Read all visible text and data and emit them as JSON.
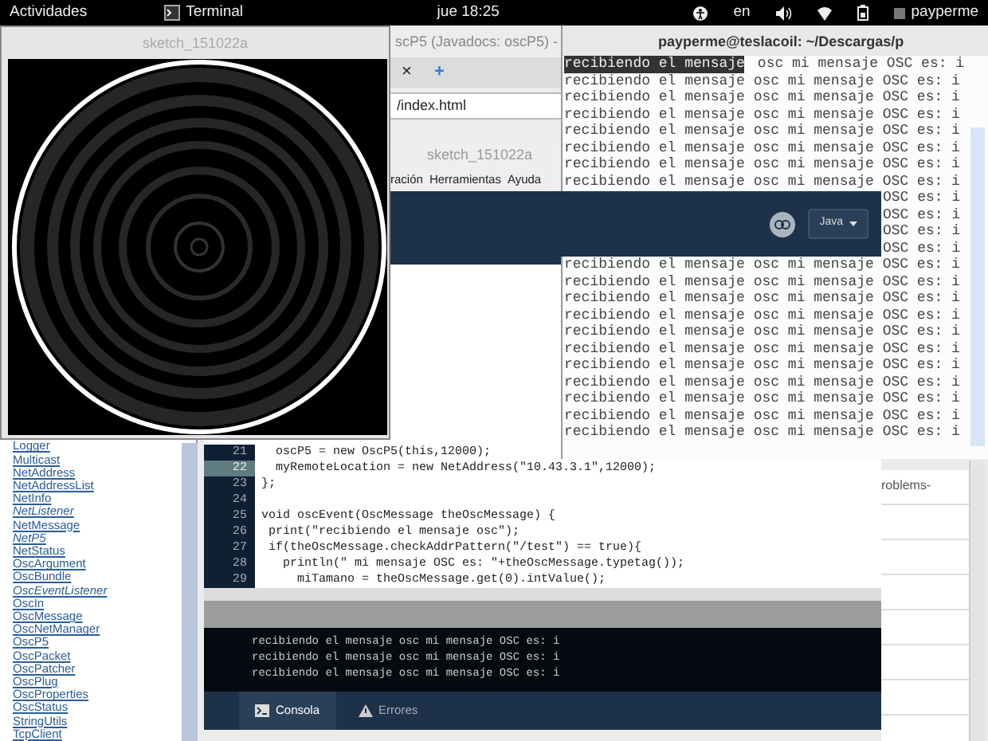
{
  "top_bar": {
    "activities": "Actividades",
    "app": "Terminal",
    "clock": "jue 18:25",
    "language": "en",
    "user": "payperme"
  },
  "browser": {
    "title": "scP5 (Javadocs: oscP5) -",
    "tab_close": "×",
    "new_tab": "+",
    "url": "/index.html",
    "content_text": "roblems-",
    "classes": [
      {
        "label": "Logger",
        "kind": "class"
      },
      {
        "label": "Multicast",
        "kind": "class"
      },
      {
        "label": "NetAddress",
        "kind": "class"
      },
      {
        "label": "NetAddressList",
        "kind": "class"
      },
      {
        "label": "NetInfo",
        "kind": "class"
      },
      {
        "label": "NetListener",
        "kind": "interface"
      },
      {
        "label": "NetMessage",
        "kind": "class"
      },
      {
        "label": "NetP5",
        "kind": "interface"
      },
      {
        "label": "NetStatus",
        "kind": "class"
      },
      {
        "label": "OscArgument",
        "kind": "class"
      },
      {
        "label": "OscBundle",
        "kind": "class"
      },
      {
        "label": "OscEventListener",
        "kind": "interface"
      },
      {
        "label": "OscIn",
        "kind": "class"
      },
      {
        "label": "OscMessage",
        "kind": "class"
      },
      {
        "label": "OscNetManager",
        "kind": "class"
      },
      {
        "label": "OscP5",
        "kind": "class"
      },
      {
        "label": "OscPacket",
        "kind": "class"
      },
      {
        "label": "OscPatcher",
        "kind": "class"
      },
      {
        "label": "OscPlug",
        "kind": "class"
      },
      {
        "label": "OscProperties",
        "kind": "class"
      },
      {
        "label": "OscStatus",
        "kind": "class"
      },
      {
        "label": "StringUtils",
        "kind": "class"
      },
      {
        "label": "TcpClient",
        "kind": "class"
      }
    ]
  },
  "editor": {
    "title": "sketch_151022a",
    "menu": [
      "ración",
      "Herramientas",
      "Ayuda"
    ],
    "mode": "Java",
    "code_lines": [
      {
        "number": "21",
        "code": "  oscP5 = new OscP5(this,12000);",
        "selected": false
      },
      {
        "number": "22",
        "code": "  myRemoteLocation = new NetAddress(\"10.43.3.1\",12000);",
        "selected": true
      },
      {
        "number": "23",
        "code": "};",
        "selected": false
      },
      {
        "number": "24",
        "selected": false
      },
      {
        "number": "25",
        "code": "void oscEvent(OscMessage theOscMessage) {",
        "selected": false
      },
      {
        "number": "26",
        "code": " print(\"recibiendo el mensaje osc\");",
        "selected": false
      },
      {
        "number": "27",
        "code": " if(theOscMessage.checkAddrPattern(\"/test\") == true){",
        "selected": false
      },
      {
        "number": "28",
        "code": "   println(\" mi mensaje OSC es: \"+theOscMessage.typetag());",
        "selected": false
      },
      {
        "number": "29",
        "code": "     miTamano = theOscMessage.get(0).intValue();",
        "selected": false
      }
    ],
    "console_lines": [
      "recibiendo el mensaje osc mi mensaje OSC es: i",
      "recibiendo el mensaje osc mi mensaje OSC es: i",
      "recibiendo el mensaje osc mi mensaje OSC es: i"
    ],
    "console_tabs": [
      {
        "label": "Consola",
        "kind": "console",
        "selected": true
      },
      {
        "label": "Errores",
        "kind": "errors",
        "selected": false
      }
    ]
  },
  "sketch_window": {
    "title": "sketch_151022a"
  },
  "terminal": {
    "title": "payperme@teslacoil: ~/Descargas/p",
    "lines": [
      {
        "kind": "full",
        "selection": "recibiendo el mensaje",
        "text": "osc mi mensaje OSC es: i"
      },
      {
        "kind": "full",
        "text": "recibiendo el mensaje osc mi mensaje OSC es: i"
      },
      {
        "kind": "full",
        "text": "recibiendo el mensaje osc mi mensaje OSC es: i"
      },
      {
        "kind": "full",
        "text": "recibiendo el mensaje osc mi mensaje OSC es: i"
      },
      {
        "kind": "full",
        "text": "recibiendo el mensaje osc mi mensaje OSC es: i"
      },
      {
        "kind": "full",
        "text": "recibiendo el mensaje osc mi mensaje OSC es: i"
      },
      {
        "kind": "full",
        "text": "recibiendo el mensaje osc mi mensaje OSC es: i"
      },
      {
        "kind": "full",
        "text": "recibiendo el mensaje osc mi mensaje OSC es: i"
      },
      {
        "kind": "tail",
        "text": "OSC es: i"
      },
      {
        "kind": "tail",
        "text": "OSC es: i"
      },
      {
        "kind": "tail",
        "text": "OSC es: i"
      },
      {
        "kind": "tail",
        "text": "OSC es: i"
      },
      {
        "kind": "full",
        "text": "recibiendo el mensaje osc mi mensaje OSC es: i"
      },
      {
        "kind": "full",
        "text": "recibiendo el mensaje osc mi mensaje OSC es: i"
      },
      {
        "kind": "full",
        "text": "recibiendo el mensaje osc mi mensaje OSC es: i"
      },
      {
        "kind": "full",
        "text": "recibiendo el mensaje osc mi mensaje OSC es: i"
      },
      {
        "kind": "full",
        "text": "recibiendo el mensaje osc mi mensaje OSC es: i"
      },
      {
        "kind": "full",
        "text": "recibiendo el mensaje osc mi mensaje OSC es: i"
      },
      {
        "kind": "full",
        "text": "recibiendo el mensaje osc mi mensaje OSC es: i"
      },
      {
        "kind": "full",
        "text": "recibiendo el mensaje osc mi mensaje OSC es: i"
      },
      {
        "kind": "full",
        "text": "recibiendo el mensaje osc mi mensaje OSC es: i"
      },
      {
        "kind": "full",
        "text": "recibiendo el mensaje osc mi mensaje OSC es: i"
      },
      {
        "kind": "full",
        "text": "recibiendo el mensaje osc mi mensaje OSC es: i"
      }
    ]
  }
}
